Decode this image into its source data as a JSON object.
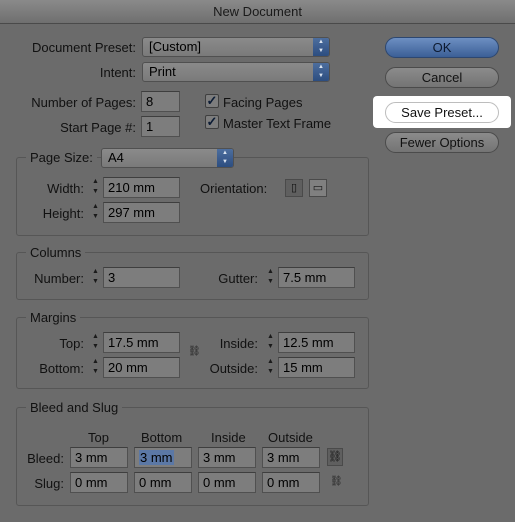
{
  "window": {
    "title": "New Document"
  },
  "preset": {
    "label": "Document Preset:",
    "value": "[Custom]"
  },
  "intent": {
    "label": "Intent:",
    "value": "Print"
  },
  "pages": {
    "count_label": "Number of Pages:",
    "count_value": "8",
    "start_label": "Start Page #:",
    "start_value": "1",
    "facing_label": "Facing Pages",
    "facing_checked": true,
    "master_label": "Master Text Frame",
    "master_checked": true
  },
  "buttons": {
    "ok": "OK",
    "cancel": "Cancel",
    "save_preset": "Save Preset...",
    "fewer_options": "Fewer Options"
  },
  "page_size": {
    "label": "Page Size:",
    "value": "A4",
    "width_label": "Width:",
    "width_value": "210 mm",
    "height_label": "Height:",
    "height_value": "297 mm",
    "orientation_label": "Orientation:",
    "orientation": "portrait"
  },
  "columns": {
    "title": "Columns",
    "number_label": "Number:",
    "number_value": "3",
    "gutter_label": "Gutter:",
    "gutter_value": "7.5 mm"
  },
  "margins": {
    "title": "Margins",
    "top_label": "Top:",
    "top_value": "17.5 mm",
    "bottom_label": "Bottom:",
    "bottom_value": "20 mm",
    "inside_label": "Inside:",
    "inside_value": "12.5 mm",
    "outside_label": "Outside:",
    "outside_value": "15 mm"
  },
  "bleed_slug": {
    "title": "Bleed and Slug",
    "col_top": "Top",
    "col_bottom": "Bottom",
    "col_inside": "Inside",
    "col_outside": "Outside",
    "bleed_label": "Bleed:",
    "bleed": [
      "3 mm",
      "3 mm",
      "3 mm",
      "3 mm"
    ],
    "slug_label": "Slug:",
    "slug": [
      "0 mm",
      "0 mm",
      "0 mm",
      "0 mm"
    ]
  },
  "colors": {
    "accent": "#3b5f96",
    "dialog_bg": "#6b6b6b",
    "highlight": "#ffffff"
  },
  "icons": [
    "stepper-icon",
    "popup-arrows-icon",
    "checkmark-icon",
    "portrait-icon",
    "landscape-icon",
    "chain-link-icon"
  ]
}
